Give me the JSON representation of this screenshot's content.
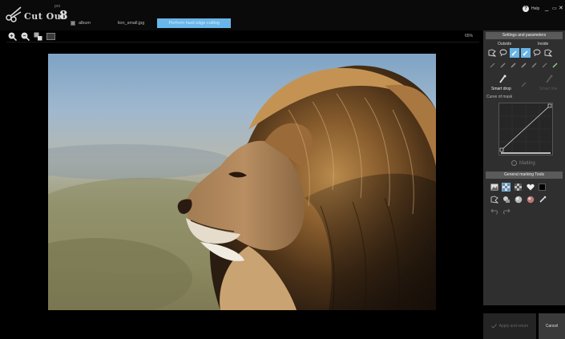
{
  "app": {
    "logo_text": "Cut Out",
    "logo_version": "8",
    "logo_edition": "pro"
  },
  "tabs": [
    {
      "label": "album",
      "icon": "album-icon"
    },
    {
      "label": "lion_small.jpg"
    },
    {
      "label": "Perform hard edge cutting",
      "active": true
    }
  ],
  "window": {
    "help_label": "Help",
    "minimize": "_",
    "maximize": "▭",
    "close": "✕"
  },
  "zoom": {
    "tools": [
      "zoom-in-icon",
      "zoom-out-icon",
      "actual-size-icon",
      "fit-window-icon"
    ],
    "level": "65%"
  },
  "panel": {
    "settings_title": "Settings and parameters",
    "outside_label": "Outside",
    "inside_label": "Inside",
    "smart_drop_label": "Smart drop",
    "smart_drop_right_label": "Smart line",
    "curve_label": "Curve of mask",
    "matting_label": "Matting",
    "tools_title": "General marking Tools"
  },
  "buttons": {
    "apply": "Apply and return",
    "cancel": "Cancel"
  },
  "colors": {
    "accent": "#6ab5e6",
    "panel_bg": "#2f2f2f",
    "header_bg": "#5a5a5a"
  }
}
